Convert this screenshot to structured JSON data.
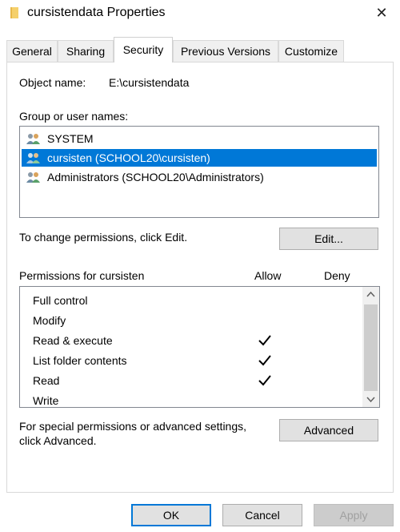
{
  "window": {
    "title": "cursistendata Properties",
    "close_glyph": "✕",
    "accent": "#0078d7"
  },
  "tabs": [
    {
      "label": "General",
      "active": false
    },
    {
      "label": "Sharing",
      "active": false
    },
    {
      "label": "Security",
      "active": true
    },
    {
      "label": "Previous Versions",
      "active": false
    },
    {
      "label": "Customize",
      "active": false
    }
  ],
  "security": {
    "object_name_label": "Object name:",
    "object_name_value": "E:\\cursistendata",
    "group_label": "Group or user names:",
    "groups": [
      {
        "name": "SYSTEM",
        "icon": "users-icon",
        "selected": false
      },
      {
        "name": "cursisten (SCHOOL20\\cursisten)",
        "icon": "users-icon",
        "selected": true
      },
      {
        "name": "Administrators (SCHOOL20\\Administrators)",
        "icon": "users-icon",
        "selected": false
      }
    ],
    "change_hint": "To change permissions, click Edit.",
    "edit_label": "Edit...",
    "permissions_header": "Permissions for cursisten",
    "allow_header": "Allow",
    "deny_header": "Deny",
    "permissions": [
      {
        "name": "Full control",
        "allow": false,
        "deny": false
      },
      {
        "name": "Modify",
        "allow": false,
        "deny": false
      },
      {
        "name": "Read & execute",
        "allow": true,
        "deny": false
      },
      {
        "name": "List folder contents",
        "allow": true,
        "deny": false
      },
      {
        "name": "Read",
        "allow": true,
        "deny": false
      },
      {
        "name": "Write",
        "allow": false,
        "deny": false
      }
    ],
    "special_hint_line1": "For special permissions or advanced settings,",
    "special_hint_line2": "click Advanced.",
    "advanced_label": "Advanced"
  },
  "footer": {
    "ok_label": "OK",
    "cancel_label": "Cancel",
    "apply_label": "Apply"
  }
}
